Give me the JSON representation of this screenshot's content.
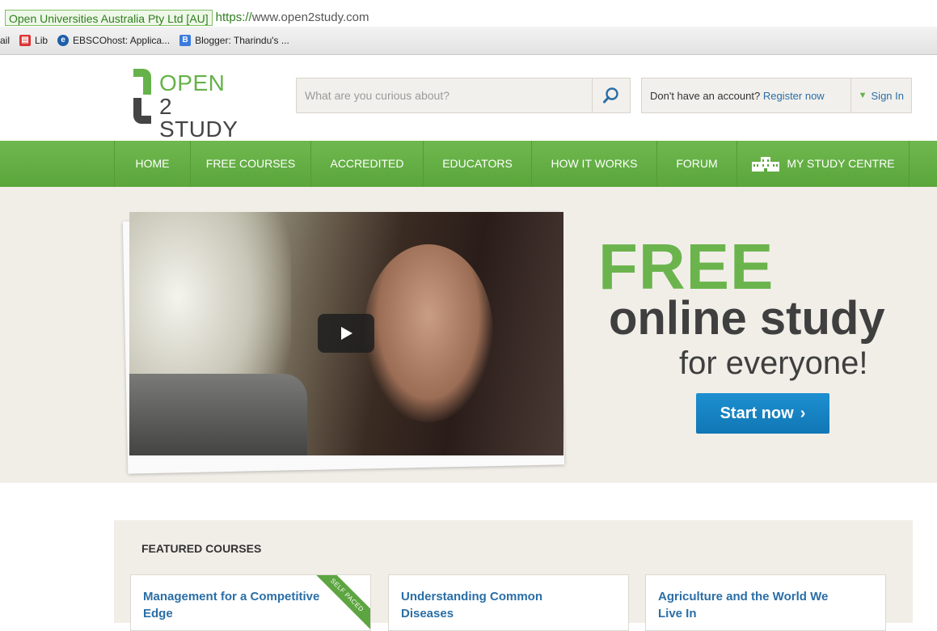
{
  "browser": {
    "secure_badge": "Open Universities Australia Pty Ltd [AU]",
    "url_scheme": "https://",
    "url_rest": "www.open2study.com",
    "bookmarks": [
      {
        "label": "ail",
        "icon": "none"
      },
      {
        "label": "Lib",
        "icon": "lib-icon"
      },
      {
        "label": "EBSCOhost: Applica...",
        "icon": "ebsco-icon"
      },
      {
        "label": "Blogger: Tharindu's ...",
        "icon": "blogger-icon"
      }
    ]
  },
  "header": {
    "logo_top": "OPEN",
    "logo_bottom": "2 STUDY",
    "search_placeholder": "What are you curious about?",
    "account_prompt": "Don't have an account?",
    "register_label": "Register now",
    "signin_label": "Sign In"
  },
  "nav": {
    "items": [
      {
        "label": "HOME"
      },
      {
        "label": "FREE COURSES"
      },
      {
        "label": "ACCREDITED"
      },
      {
        "label": "EDUCATORS"
      },
      {
        "label": "HOW IT WORKS"
      },
      {
        "label": "FORUM"
      },
      {
        "label": "MY STUDY CENTRE",
        "icon": "building-icon"
      }
    ]
  },
  "hero": {
    "line1": "FREE",
    "line2": "online study",
    "line3": "for everyone!",
    "cta_label": "Start now",
    "cta_arrow": "›"
  },
  "featured": {
    "title": "FEATURED COURSES",
    "cards": [
      {
        "title": "Management for a Competitive Edge",
        "ribbon": "SELF PACED"
      },
      {
        "title": "Understanding Common Diseases"
      },
      {
        "title": "Agriculture and the World We Live In"
      }
    ]
  },
  "colors": {
    "brand_green": "#6bb44d",
    "link_blue": "#2a6ea6",
    "cta_blue": "#1680c2",
    "hero_bg": "#f1eee8"
  }
}
